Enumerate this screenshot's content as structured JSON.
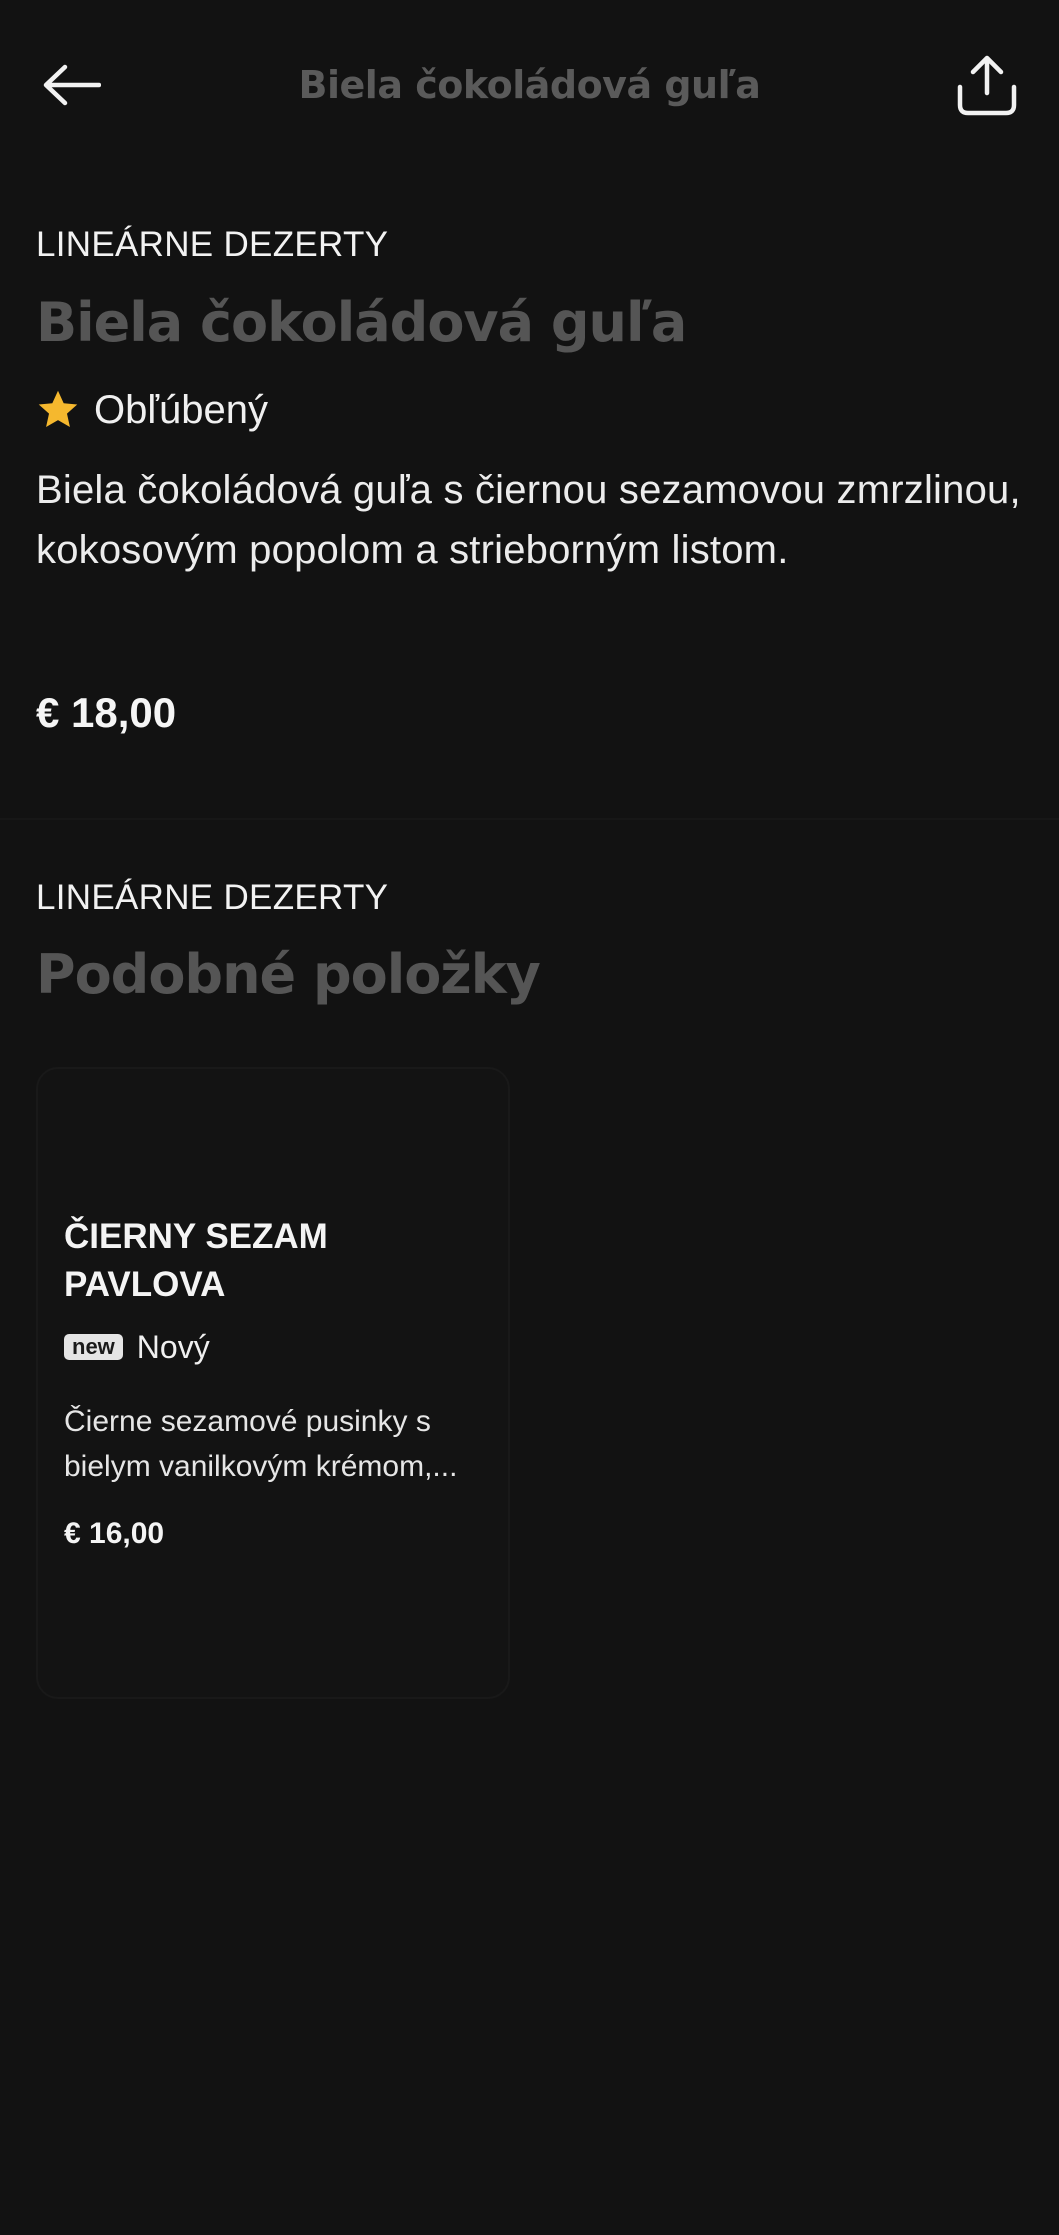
{
  "header": {
    "title": "Biela čokoládová guľa",
    "back_icon": "arrow-left-icon",
    "share_icon": "share-icon"
  },
  "item": {
    "category": "LINEÁRNE DEZERTY",
    "title": "Biela čokoládová guľa",
    "favorite_label": "Obľúbený",
    "favorite_icon": "star-icon",
    "description": "Biela čokoládová guľa s čiernou sezamovou zmrzlinou, kokosovým popolom a strieborným listom.",
    "price": "€ 18,00"
  },
  "similar": {
    "category": "LINEÁRNE DEZERTY",
    "title": "Podobné položky",
    "items": [
      {
        "title": "ČIERNY SEZAM PAVLOVA",
        "badge": "new",
        "badge_label": "Nový",
        "description": "Čierne sezamové pusinky s bielym vanilkovým krémom,...",
        "price": "€ 16,00"
      }
    ]
  },
  "colors": {
    "background": "#121212",
    "title_muted": "#555555",
    "star": "#f5b82e",
    "text": "#f2f2f2"
  }
}
